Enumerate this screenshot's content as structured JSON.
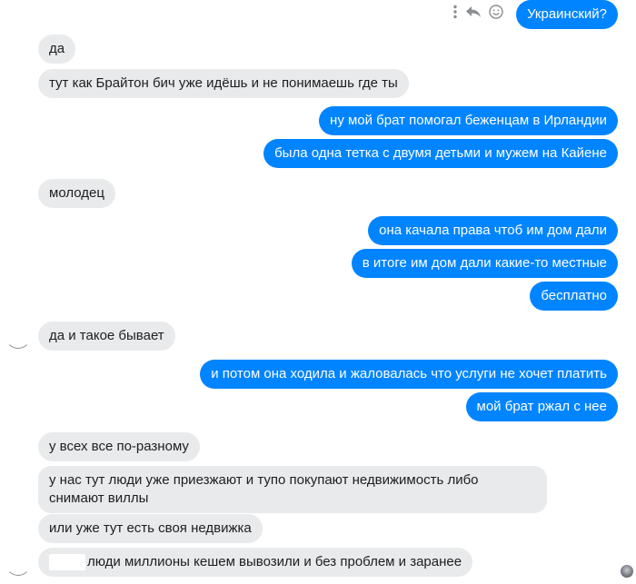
{
  "messages": [
    {
      "side": "out",
      "text": "Украинский?"
    },
    {
      "side": "in",
      "text": "да"
    },
    {
      "side": "in",
      "text": "тут как Брайтон бич уже идёшь и не понимаешь где ты"
    },
    {
      "side": "out",
      "text": "ну мой брат помогал беженцам в Ирландии"
    },
    {
      "side": "out",
      "text": "была одна тетка с двумя детьми и мужем на Кайене"
    },
    {
      "side": "in",
      "text": "молодец"
    },
    {
      "side": "out",
      "text": "она качала права чтоб им дом дали"
    },
    {
      "side": "out",
      "text": "в итоге им дом дали какие-то местные"
    },
    {
      "side": "out",
      "text": "бесплатно"
    },
    {
      "side": "in",
      "text": "да и такое бывает"
    },
    {
      "side": "out",
      "text": "и потом она ходила и жаловалась что услуги не хочет платить"
    },
    {
      "side": "out",
      "text": "мой брат ржал с нее"
    },
    {
      "side": "in",
      "text": "у всех все по-разному"
    },
    {
      "side": "in",
      "text": "у нас тут люди уже приезжают и тупо покупают недвижимость либо снимают виллы"
    },
    {
      "side": "in",
      "text": "или уже тут есть своя недвижка"
    },
    {
      "side": "in",
      "text": "люди миллионы кешем вывозили и без проблем и заранее"
    }
  ],
  "message_actions": [
    "more-icon",
    "reply-icon",
    "react-icon"
  ],
  "colors": {
    "outgoing": "#0084ff",
    "incoming": "#e9eaeb",
    "text_dark": "#1c1e21",
    "text_light": "#ffffff"
  }
}
